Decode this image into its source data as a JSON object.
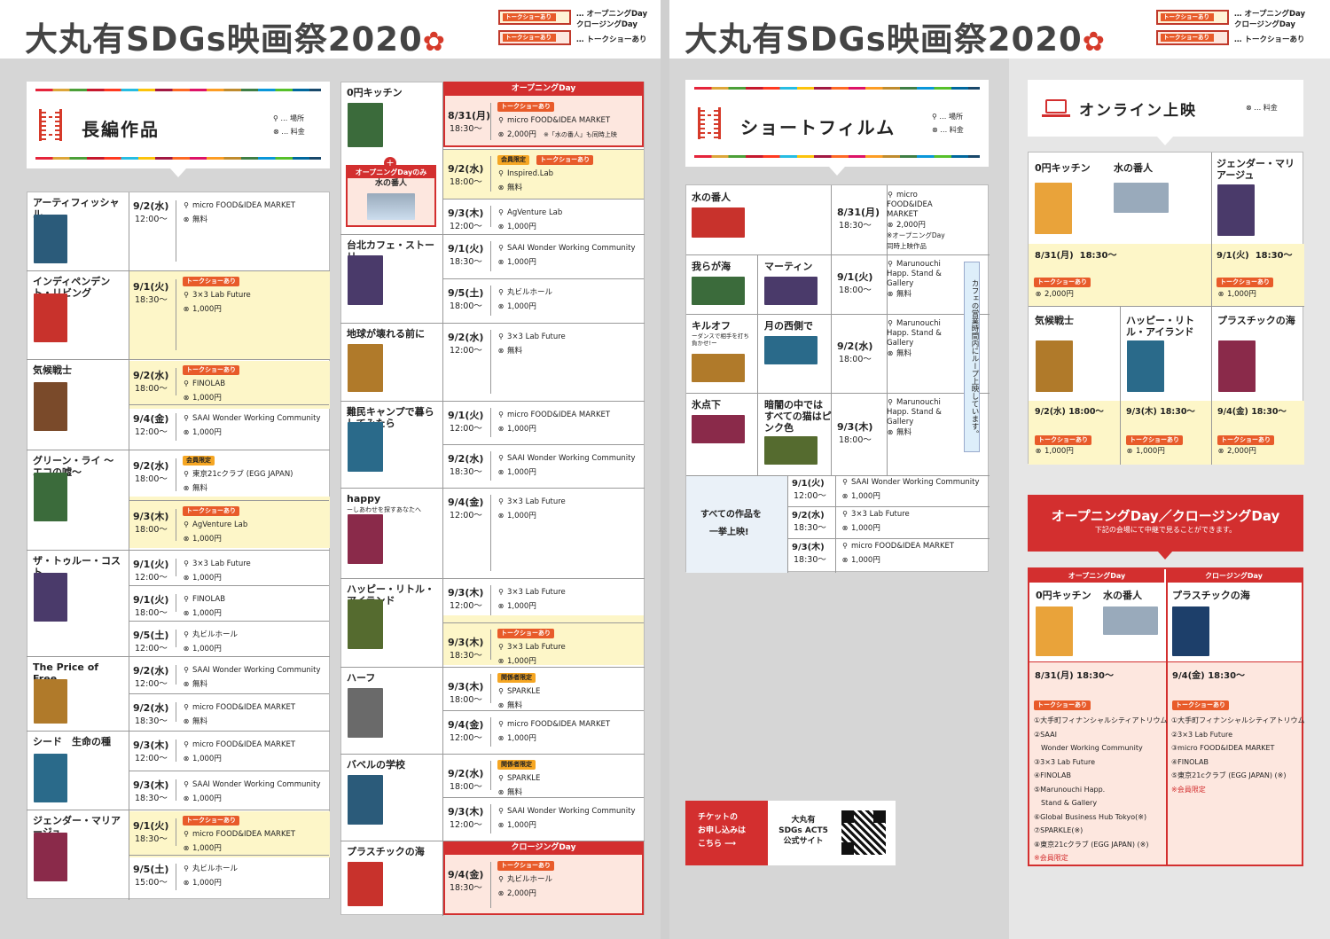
{
  "header": {
    "logo_text": "大丸有SDGs映画祭2020",
    "legend": [
      {
        "tag": "トークショーあり",
        "text1": "… オープニングDay",
        "text2": "クロージングDay"
      },
      {
        "tag": "トークショーあり",
        "text1": "… トークショーあり",
        "text2": ""
      }
    ]
  },
  "legend_icons": {
    "place": "… 場所",
    "fee": "… 料金"
  },
  "feature": {
    "title": "長編作品",
    "films": [
      {
        "name": "アーティフィッシャル",
        "shows": [
          {
            "date": "9/2(水)",
            "time": "12:00〜",
            "place": "micro FOOD&IDEA MARKET",
            "fee": "無料"
          }
        ]
      },
      {
        "name": "インディペンデント・リビング",
        "shows": [
          {
            "date": "9/1(火)",
            "time": "18:30〜",
            "badge": "トークショーあり",
            "place": "3×3 Lab Future",
            "fee": "1,000円"
          }
        ]
      },
      {
        "name": "気候戦士",
        "shows": [
          {
            "date": "9/2(水)",
            "time": "18:00〜",
            "badge": "トークショーあり",
            "place": "FINOLAB",
            "fee": "1,000円"
          },
          {
            "date": "9/4(金)",
            "time": "12:00〜",
            "place": "SAAI Wonder Working Community",
            "fee": "1,000円"
          }
        ]
      },
      {
        "name": "グリーン・ライ 〜エコの嘘〜",
        "shows": [
          {
            "date": "9/2(水)",
            "time": "18:00〜",
            "badge": "会員限定",
            "place": "東京21cクラブ (EGG JAPAN)",
            "fee": "無料"
          },
          {
            "date": "9/3(木)",
            "time": "18:00〜",
            "badge": "トークショーあり",
            "place": "AgVenture Lab",
            "fee": "1,000円"
          }
        ]
      },
      {
        "name": "ザ・トゥルー・コスト",
        "shows": [
          {
            "date": "9/1(火)",
            "time": "12:00〜",
            "place": "3×3 Lab Future",
            "fee": "1,000円"
          },
          {
            "date": "9/1(火)",
            "time": "18:00〜",
            "place": "FINOLAB",
            "fee": "1,000円"
          },
          {
            "date": "9/5(土)",
            "time": "12:00〜",
            "place": "丸ビルホール",
            "fee": "1,000円"
          }
        ]
      },
      {
        "name": "The Price of Free",
        "shows": [
          {
            "date": "9/2(水)",
            "time": "12:00〜",
            "place": "SAAI Wonder Working Community",
            "fee": "無料"
          },
          {
            "date": "9/2(水)",
            "time": "18:30〜",
            "place": "micro FOOD&IDEA MARKET",
            "fee": "無料"
          }
        ]
      },
      {
        "name": "シード　生命の種",
        "shows": [
          {
            "date": "9/3(木)",
            "time": "12:00〜",
            "place": "micro FOOD&IDEA MARKET",
            "fee": "1,000円"
          },
          {
            "date": "9/3(木)",
            "time": "18:30〜",
            "place": "SAAI Wonder Working Community",
            "fee": "1,000円"
          }
        ]
      },
      {
        "name": "ジェンダー・マリアージュ",
        "shows": [
          {
            "date": "9/1(火)",
            "time": "18:30〜",
            "badge": "トークショーあり",
            "place": "micro FOOD&IDEA MARKET",
            "fee": "1,000円"
          },
          {
            "date": "9/5(土)",
            "time": "15:00〜",
            "place": "丸ビルホール",
            "fee": "1,000円"
          }
        ]
      }
    ]
  },
  "feature2": {
    "opening_label": "オープニングDay",
    "closing_label": "クロージングDay",
    "opening_only": "オープニングDayのみ",
    "opening_only_film": "水の番人",
    "films": [
      {
        "name": "0円キッチン",
        "shows": [
          {
            "date": "8/31(月)",
            "time": "18:30〜",
            "badge": "トークショーあり",
            "place": "micro FOOD&IDEA MARKET",
            "fee": "2,000円",
            "note": "※「水の番人」も同時上映"
          },
          {
            "date": "9/2(水)",
            "time": "18:00〜",
            "badge": "会員限定",
            "badge2": "トークショーあり",
            "place": "Inspired.Lab",
            "fee": "無料"
          },
          {
            "date": "9/3(木)",
            "time": "12:00〜",
            "place": "AgVenture Lab",
            "fee": "1,000円"
          }
        ]
      },
      {
        "name": "台北カフェ・ストーリー",
        "shows": [
          {
            "date": "9/1(火)",
            "time": "18:30〜",
            "place": "SAAI Wonder Working Community",
            "fee": "1,000円"
          },
          {
            "date": "9/5(土)",
            "time": "18:00〜",
            "place": "丸ビルホール",
            "fee": "1,000円"
          }
        ]
      },
      {
        "name": "地球が壊れる前に",
        "shows": [
          {
            "date": "9/2(水)",
            "time": "12:00〜",
            "place": "3×3 Lab Future",
            "fee": "無料"
          }
        ]
      },
      {
        "name": "難民キャンプで暮らしてみたら",
        "shows": [
          {
            "date": "9/1(火)",
            "time": "12:00〜",
            "place": "micro FOOD&IDEA MARKET",
            "fee": "1,000円"
          },
          {
            "date": "9/2(水)",
            "time": "18:30〜",
            "place": "SAAI Wonder Working Community",
            "fee": "1,000円"
          }
        ]
      },
      {
        "name": "happy",
        "sub": "ーしあわせを探すあなたへ",
        "shows": [
          {
            "date": "9/4(金)",
            "time": "12:00〜",
            "place": "3×3 Lab Future",
            "fee": "1,000円"
          }
        ]
      },
      {
        "name": "ハッピー・リトル・アイランド",
        "shows": [
          {
            "date": "9/3(木)",
            "time": "12:00〜",
            "place": "3×3 Lab Future",
            "fee": "1,000円"
          },
          {
            "date": "9/3(木)",
            "time": "18:30〜",
            "badge": "トークショーあり",
            "place": "3×3 Lab Future",
            "fee": "1,000円"
          }
        ]
      },
      {
        "name": "ハーフ",
        "shows": [
          {
            "date": "9/3(木)",
            "time": "18:00〜",
            "badge": "関係者限定",
            "place": "SPARKLE",
            "fee": "無料"
          },
          {
            "date": "9/4(金)",
            "time": "12:00〜",
            "place": "micro FOOD&IDEA MARKET",
            "fee": "1,000円"
          }
        ]
      },
      {
        "name": "バベルの学校",
        "shows": [
          {
            "date": "9/2(水)",
            "time": "18:00〜",
            "badge": "関係者限定",
            "place": "SPARKLE",
            "fee": "無料"
          },
          {
            "date": "9/3(木)",
            "time": "12:00〜",
            "place": "SAAI Wonder Working Community",
            "fee": "1,000円"
          }
        ]
      },
      {
        "name": "プラスチックの海",
        "shows": [
          {
            "date": "9/4(金)",
            "time": "18:30〜",
            "badge": "トークショーあり",
            "place": "丸ビルホール",
            "fee": "2,000円"
          }
        ]
      }
    ]
  },
  "short": {
    "title": "ショートフィルム",
    "rows": [
      {
        "films": [
          "水の番人"
        ],
        "date": "8/31(月)",
        "time": "18:30〜",
        "place": "micro FOOD&IDEA MARKET",
        "fee": "2,000円",
        "note1": "※オープニングDay",
        "note2": "同時上映作品"
      },
      {
        "films": [
          "我らが海",
          "マーティン"
        ],
        "date": "9/1(火)",
        "time": "18:00〜",
        "place": "Marunouchi Happ. Stand & Gallery",
        "fee": "無料"
      },
      {
        "films": [
          "キルオフ",
          "月の西側で"
        ],
        "sub": "ーダンスで相手を打ち負かせ!ー",
        "date": "9/2(水)",
        "time": "18:00〜",
        "place": "Marunouchi Happ. Stand & Gallery",
        "fee": "無料"
      },
      {
        "films": [
          "氷点下",
          "暗闇の中ではすべての猫はピンク色"
        ],
        "date": "9/3(木)",
        "time": "18:00〜",
        "place": "Marunouchi Happ. Stand & Gallery",
        "fee": "無料"
      }
    ],
    "vertical_note": "カフェの営業時間内にループ上映しています。",
    "all_label1": "すべての作品を",
    "all_label2": "一挙上映!",
    "all_shows": [
      {
        "date": "9/1(火)",
        "time": "12:00〜",
        "place": "SAAI Wonder Working Community",
        "fee": "1,000円"
      },
      {
        "date": "9/2(水)",
        "time": "18:30〜",
        "place": "3×3 Lab Future",
        "fee": "1,000円"
      },
      {
        "date": "9/3(木)",
        "time": "18:30〜",
        "place": "micro FOOD&IDEA MARKET",
        "fee": "1,000円"
      }
    ]
  },
  "ticket": {
    "line1": "チケットの",
    "line2": "お申し込みは",
    "line3": "こちら",
    "site1": "大丸有",
    "site2": "SDGs ACT5",
    "site3": "公式サイト"
  },
  "online": {
    "title": "オンライン上映",
    "fee_legend": "… 料金",
    "row1": [
      {
        "name": "0円キッチン",
        "name2": "水の番人",
        "date": "8/31(月)",
        "time": "18:30〜",
        "badge": "トークショーあり",
        "fee": "2,000円"
      },
      {
        "name": "ジェンダー・マリアージュ",
        "date": "9/1(火)",
        "time": "18:30〜",
        "badge": "トークショーあり",
        "fee": "1,000円"
      }
    ],
    "row2": [
      {
        "name": "気候戦士",
        "date": "9/2(水)",
        "time": "18:00〜",
        "badge": "トークショーあり",
        "fee": "1,000円"
      },
      {
        "name": "ハッピー・リトル・アイランド",
        "date": "9/3(木)",
        "time": "18:30〜",
        "badge": "トークショーあり",
        "fee": "1,000円"
      },
      {
        "name": "プラスチックの海",
        "date": "9/4(金)",
        "time": "18:30〜",
        "badge": "トークショーあり",
        "fee": "2,000円"
      }
    ]
  },
  "ocd": {
    "title": "オープニングDay／クロージングDay",
    "subtitle": "下記の会場にて中継で見ることができます。",
    "opening": {
      "label": "オープニングDay",
      "film1": "0円キッチン",
      "film2": "水の番人",
      "date": "8/31(月)",
      "time": "18:30〜",
      "badge": "トークショーあり",
      "venues": [
        "①大手町フィナンシャルシティアトリウム",
        "②SAAI",
        "　Wonder Working Community",
        "③3×3 Lab Future",
        "④FINOLAB",
        "⑤Marunouchi Happ.",
        "　Stand & Gallery",
        "⑥Global Business Hub Tokyo(※)",
        "⑦SPARKLE(※)",
        "⑧東京21cクラブ (EGG JAPAN) (※)"
      ],
      "note": "※会員限定"
    },
    "closing": {
      "label": "クロージングDay",
      "film1": "プラスチックの海",
      "date": "9/4(金)",
      "time": "18:30〜",
      "badge": "トークショーあり",
      "venues": [
        "①大手町フィナンシャルシティアトリウム",
        "②3×3 Lab Future",
        "③micro FOOD&IDEA MARKET",
        "④FINOLAB",
        "⑤東京21cクラブ (EGG JAPAN) (※)"
      ],
      "note": "※会員限定"
    }
  }
}
